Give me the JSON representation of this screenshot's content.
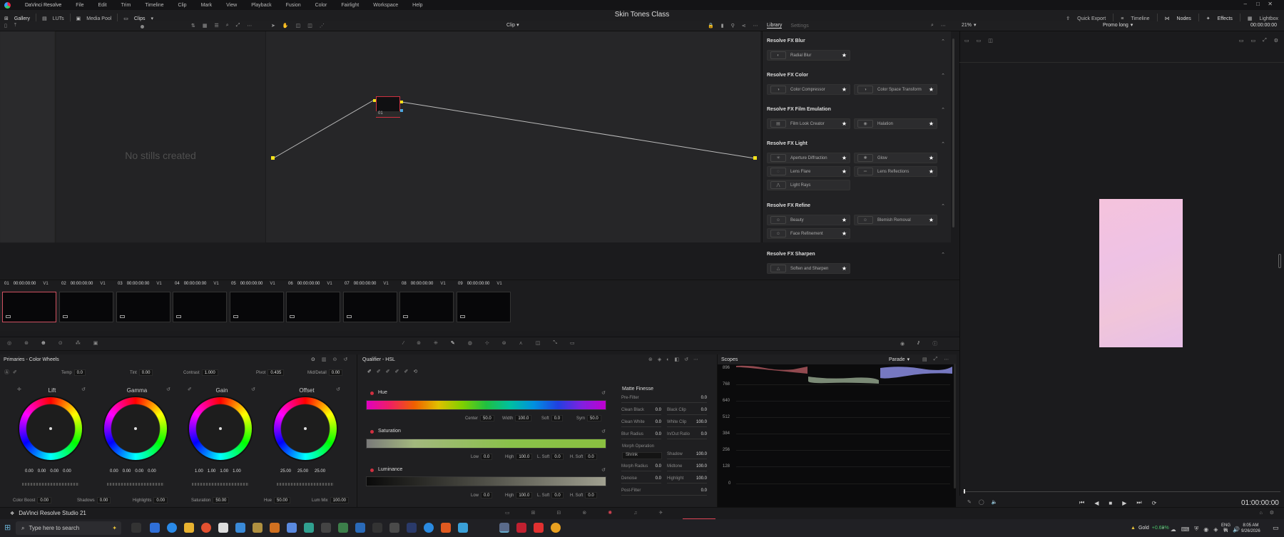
{
  "titlebar": {
    "app_name": "DaVinci Resolve",
    "menus": [
      "File",
      "Edit",
      "Trim",
      "Timeline",
      "Clip",
      "Mark",
      "View",
      "Playback",
      "Fusion",
      "Color",
      "Fairlight",
      "Workspace",
      "Help"
    ]
  },
  "project_title": "Skin Tones Class",
  "toolbar": {
    "gallery": "Gallery",
    "luts": "LUTs",
    "media_pool": "Media Pool",
    "clips": "Clips",
    "quick_export": "Quick Export",
    "timeline": "Timeline",
    "nodes": "Nodes",
    "effects": "Effects",
    "lightbox": "Lightbox"
  },
  "viewer_toolbar": {
    "mode": "Clip",
    "zoom": "21%",
    "timeline_name": "Promo long",
    "timecode_top": "00:00:00:00",
    "timecode": "01:00:00:00"
  },
  "library": {
    "tabs": [
      "Library",
      "Settings"
    ],
    "sections": [
      {
        "title": "Resolve FX Blur",
        "items": [
          "Radial Blur"
        ]
      },
      {
        "title": "Resolve FX Color",
        "items": [
          "Color Compressor",
          "Color Space Transform"
        ]
      },
      {
        "title": "Resolve FX Film Emulation",
        "items": [
          "Film Look Creator",
          "Halation"
        ]
      },
      {
        "title": "Resolve FX Light",
        "items": [
          "Aperture Diffraction",
          "Glow",
          "Lens Flare",
          "Lens Reflections",
          "Light Rays"
        ]
      },
      {
        "title": "Resolve FX Refine",
        "items": [
          "Beauty",
          "Blemish Removal",
          "Face Refinement"
        ]
      },
      {
        "title": "Resolve FX Sharpen",
        "items": [
          "Soften and Sharpen"
        ]
      }
    ]
  },
  "stills": {
    "empty_text": "No stills created"
  },
  "node": {
    "label": "01"
  },
  "clips": [
    {
      "num": "01",
      "tc": "00:00:00:00",
      "track": "V1"
    },
    {
      "num": "02",
      "tc": "00:00:00:00",
      "track": "V1"
    },
    {
      "num": "03",
      "tc": "00:00:00:00",
      "track": "V1"
    },
    {
      "num": "04",
      "tc": "00:00:00:00",
      "track": "V1"
    },
    {
      "num": "05",
      "tc": "00:00:00:00",
      "track": "V1"
    },
    {
      "num": "06",
      "tc": "00:00:00:00",
      "track": "V1"
    },
    {
      "num": "07",
      "tc": "00:00:00:00",
      "track": "V1"
    },
    {
      "num": "08",
      "tc": "00:00:00:00",
      "track": "V1"
    },
    {
      "num": "09",
      "tc": "00:00:00:00",
      "track": "V1"
    }
  ],
  "primaries": {
    "title": "Primaries - Color Wheels",
    "temp": {
      "label": "Temp",
      "value": "0.0"
    },
    "tint": {
      "label": "Tint",
      "value": "0.00"
    },
    "contrast": {
      "label": "Contrast",
      "value": "1.000"
    },
    "pivot": {
      "label": "Pivot",
      "value": "0.435"
    },
    "middetail": {
      "label": "Mid/Detail",
      "value": "0.00"
    },
    "wheels": [
      {
        "name": "Lift",
        "values": [
          "0.00",
          "0.00",
          "0.00",
          "0.00"
        ]
      },
      {
        "name": "Gamma",
        "values": [
          "0.00",
          "0.00",
          "0.00",
          "0.00"
        ]
      },
      {
        "name": "Gain",
        "values": [
          "1.00",
          "1.00",
          "1.00",
          "1.00"
        ]
      },
      {
        "name": "Offset",
        "values": [
          "25.00",
          "25.00",
          "25.00"
        ]
      }
    ],
    "colorboost": {
      "label": "Color Boost",
      "value": "0.00"
    },
    "shadows": {
      "label": "Shadows",
      "value": "0.00"
    },
    "highlights": {
      "label": "Highlights",
      "value": "0.00"
    },
    "saturation": {
      "label": "Saturation",
      "value": "50.00"
    },
    "hue": {
      "label": "Hue",
      "value": "50.00"
    },
    "lummix": {
      "label": "Lum Mix",
      "value": "100.00"
    }
  },
  "qualifier": {
    "title": "Qualifier - HSL",
    "hue": {
      "title": "Hue",
      "center": "50.0",
      "width": "100.0",
      "soft": "0.0",
      "sym": "50.0"
    },
    "saturation": {
      "title": "Saturation",
      "low": "0.0",
      "high": "100.0",
      "lsoft": "0.0",
      "hsoft": "0.0"
    },
    "luminance": {
      "title": "Luminance",
      "low": "0.0",
      "high": "100.0",
      "lsoft": "0.0",
      "hsoft": "0.0"
    },
    "labels": {
      "center": "Center",
      "width": "Width",
      "soft": "Soft",
      "sym": "Sym",
      "low": "Low",
      "high": "High",
      "lsoft": "L. Soft",
      "hsoft": "H. Soft"
    },
    "matte": {
      "title": "Matte Finesse",
      "rows": [
        [
          "Pre-Filter",
          "0.0"
        ],
        [
          "Clean Black",
          "0.0"
        ],
        [
          "Black Clip",
          "0.0"
        ],
        [
          "Clean White",
          "0.0"
        ],
        [
          "White Clip",
          "100.0"
        ],
        [
          "Blur Radius",
          "0.0"
        ],
        [
          "In/Out Ratio",
          "0.0"
        ],
        [
          "Shadow",
          "100.0"
        ],
        [
          "Morph Radius",
          "0.0"
        ],
        [
          "Midtone",
          "100.0"
        ],
        [
          "Denoise",
          "0.0"
        ],
        [
          "Highlight",
          "100.0"
        ],
        [
          "Post-Filter",
          "0.0"
        ]
      ],
      "morph_op": "Morph Operation",
      "shrink": "Shrink"
    }
  },
  "scopes": {
    "title": "Scopes",
    "mode": "Parade",
    "labels": [
      "896",
      "768",
      "640",
      "512",
      "384",
      "256",
      "128",
      "0"
    ]
  },
  "pagebar": {
    "app_label": "DaVinci Resolve Studio 21"
  },
  "taskbar": {
    "search_placeholder": "Type here to search",
    "stock_name": "Gold",
    "stock_change": "+0.69%",
    "lang": "ENG",
    "region": "IN",
    "time": "8:05 AM",
    "date": "9/26/2026"
  },
  "colors": {
    "accent": "#d0303a",
    "select": "#e04555",
    "background": "#1b1b1d"
  }
}
